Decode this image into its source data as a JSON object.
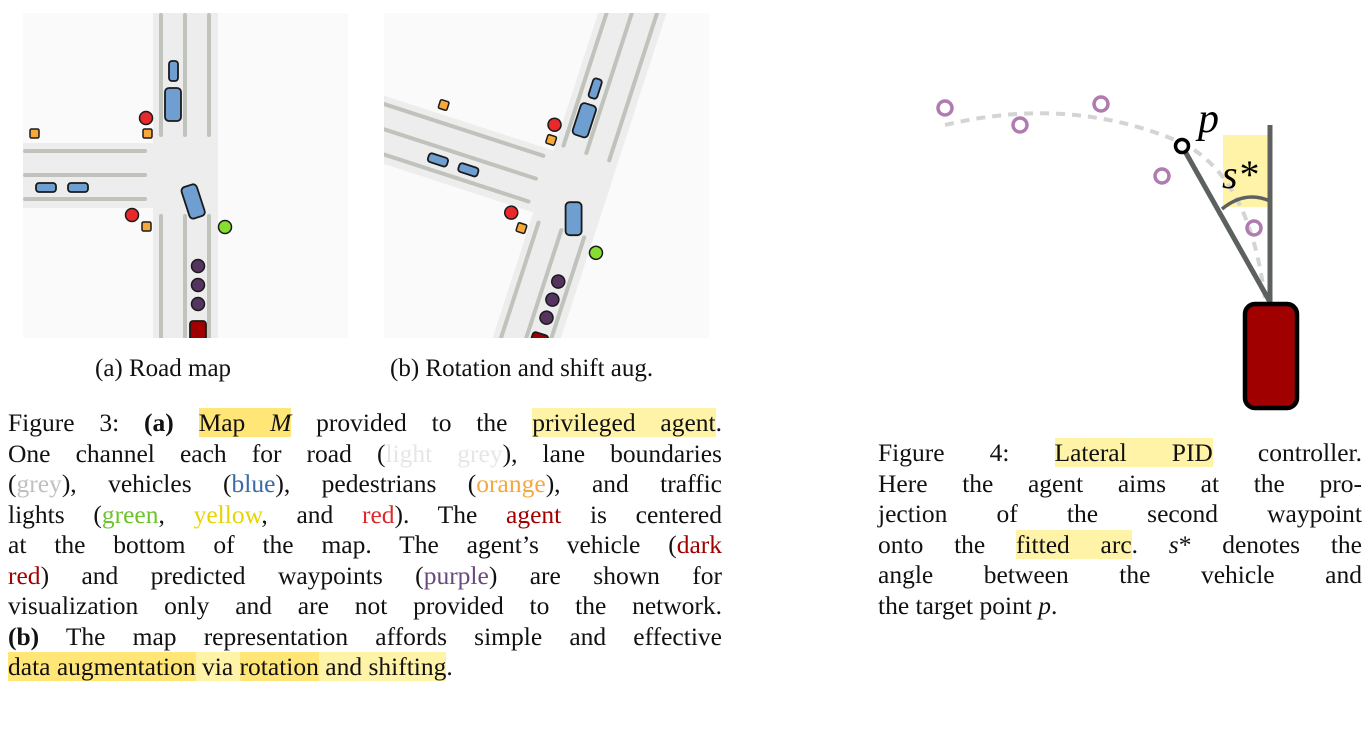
{
  "subcaptions": {
    "a": "(a) Road map",
    "b": "(b) Rotation and shift aug."
  },
  "figure3": {
    "lines": [
      [
        {
          "t": "Figure 3: "
        },
        {
          "t": "(a)",
          "b": true
        },
        {
          "t": " "
        },
        {
          "t": "Map ",
          "hl": "strong"
        },
        {
          "t": "M",
          "i": true,
          "hl": "strong"
        },
        {
          "t": " provided to the "
        },
        {
          "t": "privileged agent",
          "hl": "light"
        },
        {
          "t": "."
        }
      ],
      [
        {
          "t": "One channel each for road ("
        },
        {
          "t": "light grey",
          "color": "#e6e6e6"
        },
        {
          "t": "), lane boundaries"
        }
      ],
      [
        {
          "t": "("
        },
        {
          "t": "grey",
          "color": "#c0c0c0"
        },
        {
          "t": "), vehicles ("
        },
        {
          "t": "blue",
          "color": "#3a6aa8"
        },
        {
          "t": "), pedestrians ("
        },
        {
          "t": "orange",
          "color": "#f5a83c"
        },
        {
          "t": "), and traffic"
        }
      ],
      [
        {
          "t": "lights ("
        },
        {
          "t": "green",
          "color": "#6cc42a"
        },
        {
          "t": ", "
        },
        {
          "t": "yellow",
          "color": "#e8d400"
        },
        {
          "t": ", and "
        },
        {
          "t": "red",
          "color": "#e02828"
        },
        {
          "t": ").  The "
        },
        {
          "t": "agent",
          "color": "#a00000"
        },
        {
          "t": " is centered"
        }
      ],
      [
        {
          "t": "at the bottom of the map.  The agent’s vehicle ("
        },
        {
          "t": "dark",
          "color": "#a00000"
        }
      ],
      [
        {
          "t": "red",
          "color": "#a00000"
        },
        {
          "t": ") and predicted waypoints ("
        },
        {
          "t": "purple",
          "color": "#6a4a7e"
        },
        {
          "t": ") are shown for"
        }
      ],
      [
        {
          "t": "visualization only and are not provided to the network."
        }
      ],
      [
        {
          "t": "(b)",
          "b": true
        },
        {
          "t": " The map representation affords simple and effective"
        }
      ],
      [
        {
          "t": "data augmentation",
          "hl": "strong"
        },
        {
          "t": " via ",
          "hl": "light"
        },
        {
          "t": "rotation",
          "hl": "strong"
        },
        {
          "t": " and shifting",
          "hl": "light"
        },
        {
          "t": "."
        }
      ]
    ]
  },
  "figure4": {
    "lines": [
      [
        {
          "t": "Figure 4:  "
        },
        {
          "t": "Lateral PID",
          "hl": "light"
        },
        {
          "t": " controller."
        }
      ],
      [
        {
          "t": "Here the agent aims at the pro-"
        }
      ],
      [
        {
          "t": "jection of the second waypoint"
        }
      ],
      [
        {
          "t": "onto the "
        },
        {
          "t": "fitted arc",
          "hl": "light"
        },
        {
          "t": ". "
        },
        {
          "t": "s",
          "i": true
        },
        {
          "t": "*"
        },
        {
          "t": " denotes the"
        }
      ],
      [
        {
          "t": "angle between the vehicle and"
        }
      ],
      [
        {
          "t": "the target point "
        },
        {
          "t": "p",
          "i": true
        },
        {
          "t": "."
        }
      ]
    ]
  },
  "pid_labels": {
    "target": "p",
    "angle": "s*"
  },
  "colors": {
    "road": "#ededed",
    "background": "#fafafa",
    "lane": "#c0c2bc",
    "vehicle": "#6f9fd0",
    "pedestrian": "#f7a83a",
    "light_red": "#e8282a",
    "light_green": "#86de2e",
    "waypoint": "#553460",
    "agent": "#a00000",
    "pid_waypoint": "#b07cb0",
    "arc_dash": "#d4d4d4",
    "pid_line": "#5c6160",
    "highlight_light": "#fff3a8",
    "highlight_strong": "#ffe676"
  }
}
